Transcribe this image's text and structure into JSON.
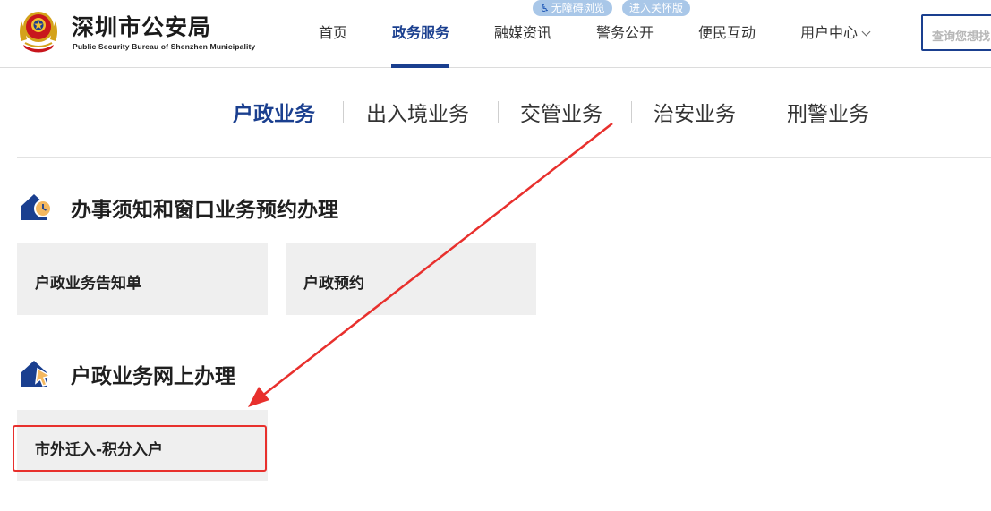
{
  "header": {
    "site_title": "深圳市公安局",
    "site_subtitle": "Public Security Bureau of Shenzhen Municipality",
    "accessibility_label": "无障碍浏览",
    "care_mode_label": "进入关怀版",
    "nav": [
      {
        "label": "首页"
      },
      {
        "label": "政务服务"
      },
      {
        "label": "融媒资讯"
      },
      {
        "label": "警务公开"
      },
      {
        "label": "便民互动"
      },
      {
        "label": "用户中心"
      }
    ],
    "search_placeholder": "查询您想找"
  },
  "categories": [
    {
      "label": "户政业务"
    },
    {
      "label": "出入境业务"
    },
    {
      "label": "交管业务"
    },
    {
      "label": "治安业务"
    },
    {
      "label": "刑警业务"
    }
  ],
  "sections": [
    {
      "title": "办事须知和窗口业务预约办理",
      "cards": [
        {
          "label": "户政业务告知单"
        },
        {
          "label": "户政预约"
        }
      ]
    },
    {
      "title": "户政业务网上办理",
      "cards": [
        {
          "label": "市外迁入-积分入户"
        }
      ]
    }
  ],
  "colors": {
    "brand_blue": "#1a3f8f",
    "annotation_red": "#e8302d",
    "card_bg": "#efefef",
    "pill_bg": "#a9c7e8"
  },
  "icons": [
    "police-emblem-icon",
    "wheelchair-icon",
    "chevron-down-icon",
    "house-clock-icon",
    "house-cursor-icon"
  ]
}
